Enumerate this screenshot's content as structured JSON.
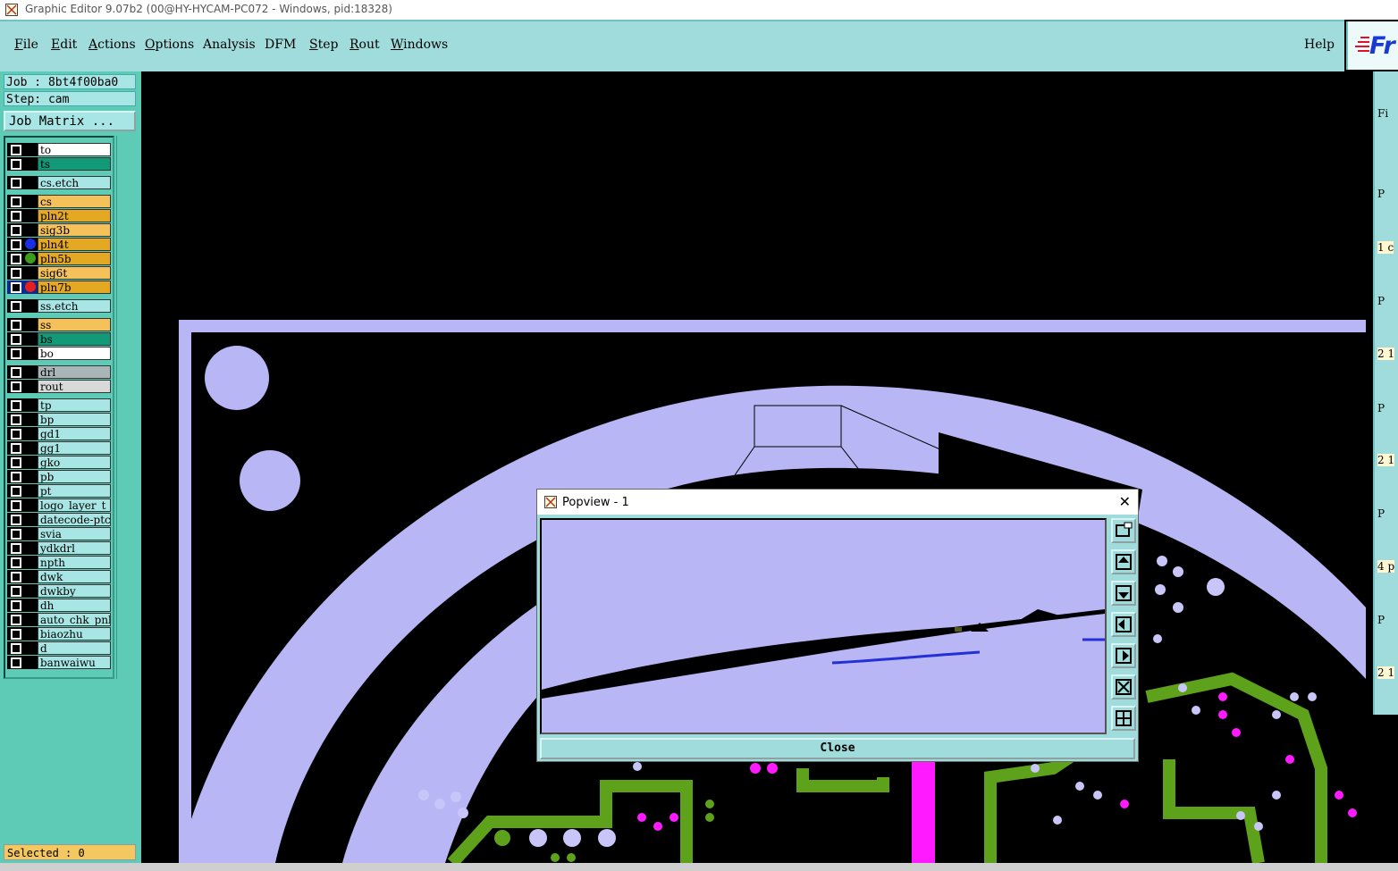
{
  "window": {
    "title": "Graphic Editor 9.07b2 (00@HY-HYCAM-PC072 - Windows, pid:18328)"
  },
  "menu": {
    "items": [
      {
        "first": "F",
        "rest": "ile"
      },
      {
        "first": "E",
        "rest": "dit"
      },
      {
        "first": "A",
        "rest": "ctions"
      },
      {
        "first": "O",
        "rest": "ptions"
      },
      {
        "first": "",
        "rest": "Analysis"
      },
      {
        "first": "",
        "rest": "DFM"
      },
      {
        "first": "S",
        "rest": "tep"
      },
      {
        "first": "R",
        "rest": "out"
      },
      {
        "first": "W",
        "rest": "indows"
      }
    ],
    "help": "Help",
    "logo": "Fr"
  },
  "job": {
    "job_label": "Job : 8bt4f00ba0",
    "step_label": "Step: cam",
    "matrix_button": "Job Matrix ..."
  },
  "layers": [
    {
      "name": "to",
      "bg": "#ffffff"
    },
    {
      "name": "ts",
      "bg": "#129a78"
    },
    {
      "name": "cs.etch",
      "bg": "#a8e6e6"
    },
    {
      "name": "cs",
      "bg": "#f5c15a"
    },
    {
      "name": "pln2t",
      "bg": "#e5a822"
    },
    {
      "name": "sig3b",
      "bg": "#f5c15a"
    },
    {
      "name": "pln4t",
      "bg": "#e5a822",
      "marker": "#1a2ee8"
    },
    {
      "name": "pln5b",
      "bg": "#e5a822",
      "marker": "#3c9d1c"
    },
    {
      "name": "sig6t",
      "bg": "#f5c15a"
    },
    {
      "name": "pln7b",
      "bg": "#e5a822",
      "marker": "#e62020",
      "active": true
    },
    {
      "name": "ss.etch",
      "bg": "#a8e6e6"
    },
    {
      "name": "ss",
      "bg": "#f5c15a"
    },
    {
      "name": "bs",
      "bg": "#129a78"
    },
    {
      "name": "bo",
      "bg": "#ffffff"
    },
    {
      "name": "drl",
      "bg": "#a9b6b8"
    },
    {
      "name": "rout",
      "bg": "#d9d9d9"
    },
    {
      "name": "tp",
      "bg": "#a8e6e6"
    },
    {
      "name": "bp",
      "bg": "#a8e6e6"
    },
    {
      "name": "gd1",
      "bg": "#a8e6e6"
    },
    {
      "name": "gg1",
      "bg": "#a8e6e6"
    },
    {
      "name": "gko",
      "bg": "#a8e6e6"
    },
    {
      "name": "pb",
      "bg": "#a8e6e6"
    },
    {
      "name": "pt",
      "bg": "#a8e6e6"
    },
    {
      "name": "logo_layer_t",
      "bg": "#a8e6e6"
    },
    {
      "name": "datecode-ptc",
      "bg": "#a8e6e6"
    },
    {
      "name": "svia",
      "bg": "#a8e6e6"
    },
    {
      "name": "ydkdrl",
      "bg": "#a8e6e6"
    },
    {
      "name": "npth",
      "bg": "#a8e6e6"
    },
    {
      "name": "dwk",
      "bg": "#a8e6e6"
    },
    {
      "name": "dwkby",
      "bg": "#a8e6e6"
    },
    {
      "name": "dh",
      "bg": "#a8e6e6"
    },
    {
      "name": "auto_chk_pnl",
      "bg": "#a8e6e6"
    },
    {
      "name": "biaozhu",
      "bg": "#a8e6e6"
    },
    {
      "name": "d",
      "bg": "#a8e6e6"
    },
    {
      "name": "banwaiwu",
      "bg": "#a8e6e6"
    }
  ],
  "status": {
    "selected": "Selected : 0"
  },
  "popview": {
    "title": "Popview - 1",
    "close_label": "Close"
  },
  "right_panel": {
    "label_fi": "Fi",
    "label_p": "P",
    "rows": [
      "1 c",
      "2 1",
      "2 1",
      "4 p",
      "2 1"
    ]
  },
  "colors": {
    "board": "#b8b6f5",
    "copper_green": "#5ea21c",
    "pad_magenta": "#ff1aff",
    "via_lavender": "#c8c6f8",
    "trace_blue": "#2330d8"
  }
}
